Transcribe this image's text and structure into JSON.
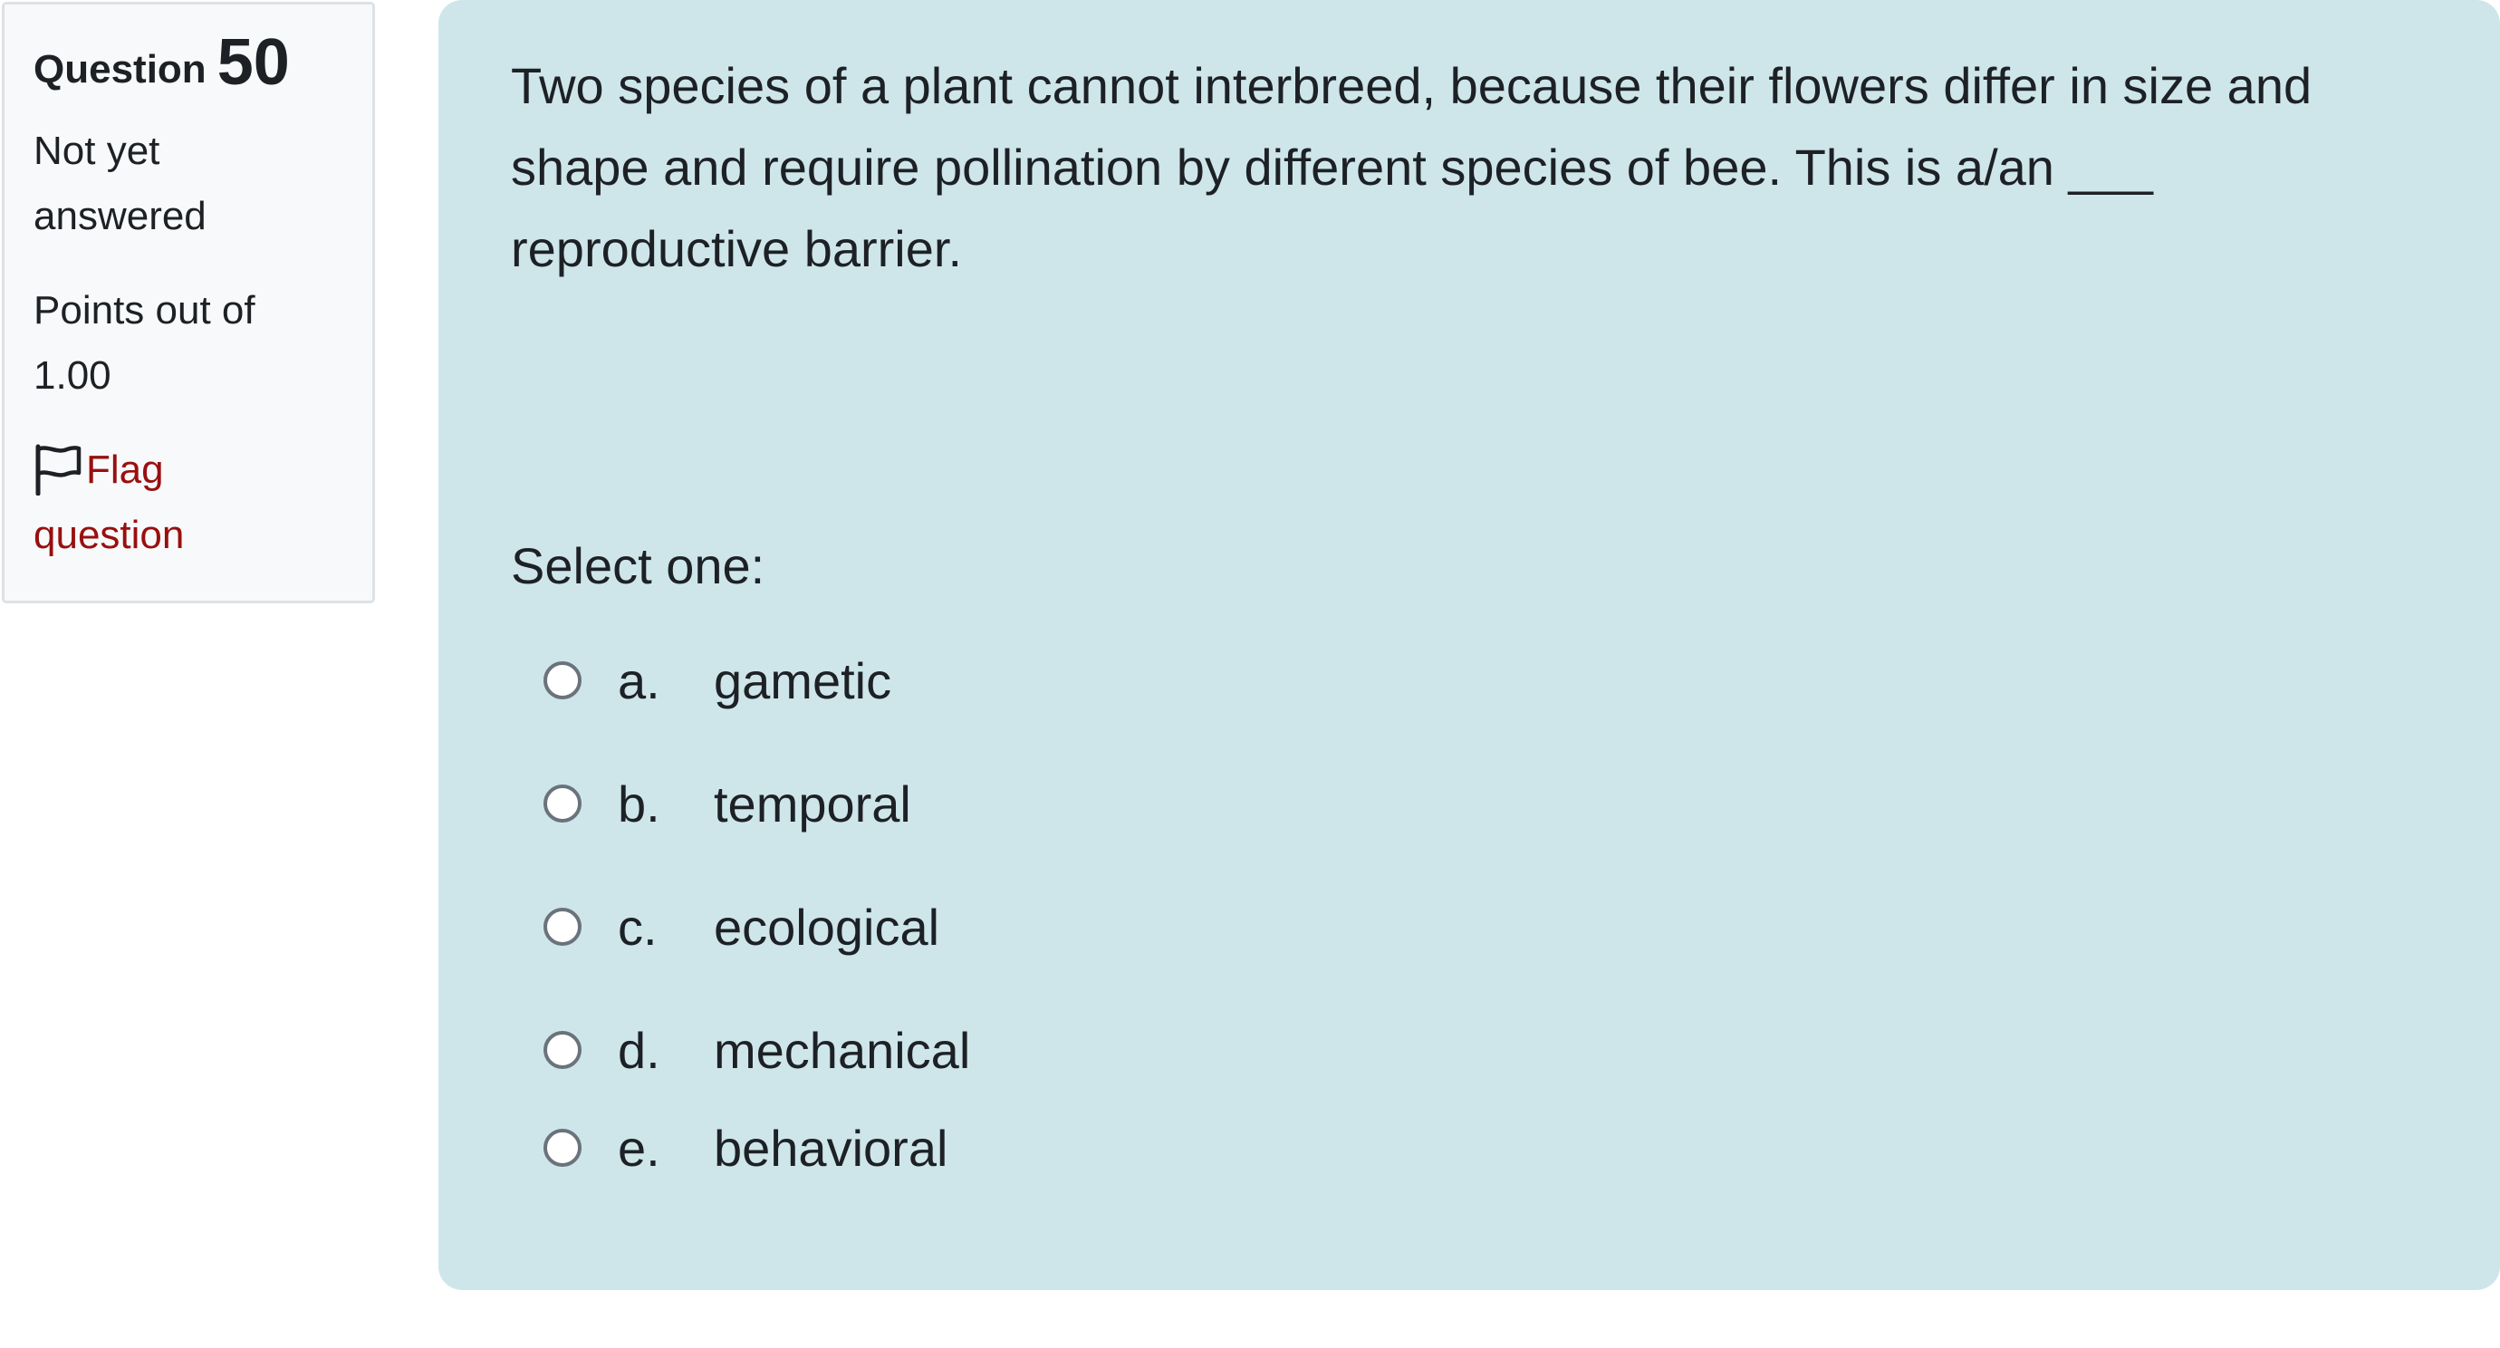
{
  "info": {
    "question_word": "Question",
    "question_number": "50",
    "state": "Not yet answered",
    "grade": "Points out of 1.00",
    "flag_label": "Flag question"
  },
  "question": {
    "text": "Two species of a plant cannot interbreed, because their flowers differ in size and shape and require pollination by different species of bee.  This is a/an ___ reproductive barrier.",
    "prompt": "Select one:",
    "options": [
      {
        "letter": "a.",
        "label": "gametic"
      },
      {
        "letter": "b.",
        "label": "temporal"
      },
      {
        "letter": "c.",
        "label": "ecological"
      },
      {
        "letter": "d.",
        "label": "mechanical"
      },
      {
        "letter": "e.",
        "label": "behavioral"
      }
    ]
  },
  "colors": {
    "info_background": "#f8f9fa",
    "content_background": "#cee6ea",
    "flag_link": "#990f0f",
    "text": "#1d2125"
  },
  "icons": {
    "flag": "flag-outline-icon",
    "radio": "radio-unchecked-icon"
  }
}
